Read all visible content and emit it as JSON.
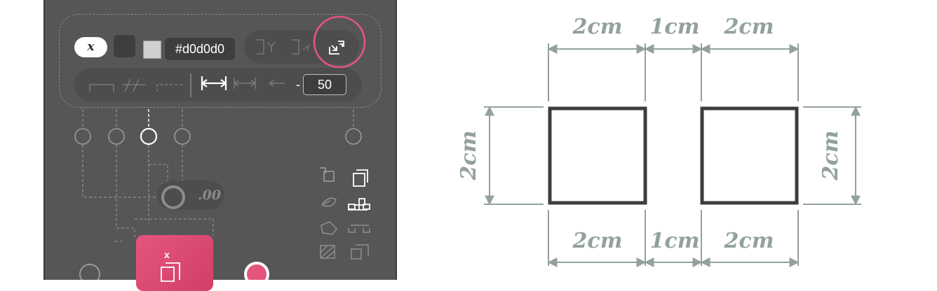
{
  "toolbar": {
    "variable_label": "x",
    "color_hex": "#d0d0d0",
    "minus_label": "-",
    "width_value": "50",
    "top_icons": [
      "bracket-y-icon",
      "bracket-arrow-icon",
      "export-icon"
    ],
    "bottom_icons": [
      "line-flat-icon",
      "line-hatched-icon",
      "line-dashed-icon",
      "dimension-bar-icon",
      "dimension-arrow-icon",
      "double-arrow-icon"
    ]
  },
  "node_graph": {
    "decimal_label": ".00",
    "node_symbol": "x",
    "side_icons": [
      "shape-overlap-icon",
      "copy-frame-icon",
      "leaf-icon",
      "hierarchy-icon",
      "polygon-icon",
      "hierarchy-outline-icon",
      "hatch-pattern-icon",
      "copy-outline-icon"
    ]
  },
  "diagram": {
    "top_labels": [
      "2cm",
      "1cm",
      "2cm"
    ],
    "bottom_labels": [
      "2cm",
      "1cm",
      "2cm"
    ],
    "left_label": "2cm",
    "right_label": "2cm"
  },
  "colors": {
    "panel_bg": "#565656",
    "accent": "#e4557d",
    "dimension": "#93a19b",
    "square_stroke": "#3d3d3d"
  }
}
